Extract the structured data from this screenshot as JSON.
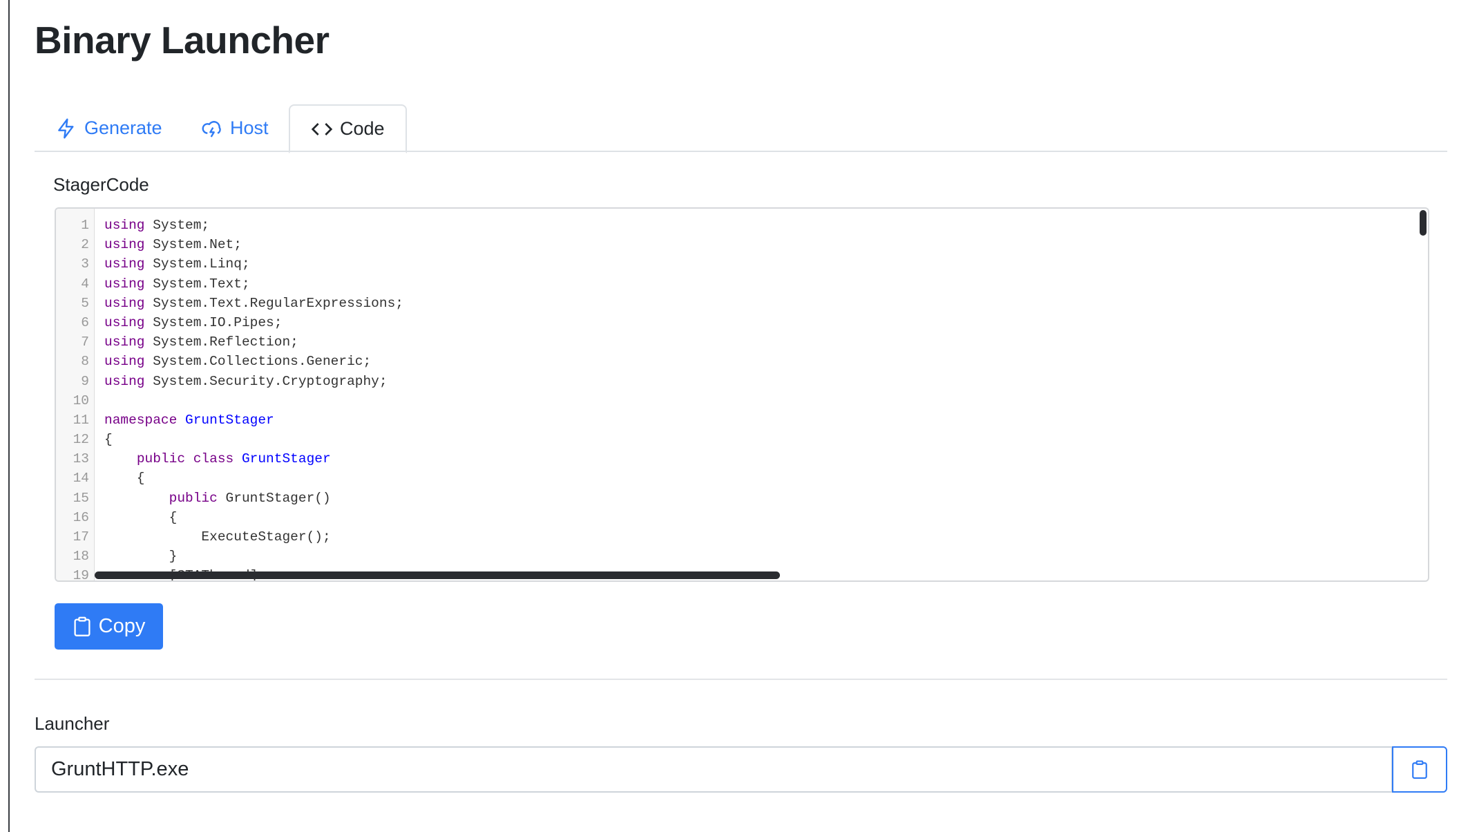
{
  "page": {
    "title": "Binary Launcher"
  },
  "tabs": [
    {
      "label": "Generate",
      "icon": "lightning-icon"
    },
    {
      "label": "Host",
      "icon": "cloud-lightning-icon"
    },
    {
      "label": "Code",
      "icon": "code-icon",
      "active": true
    }
  ],
  "stager": {
    "label": "StagerCode",
    "lines": [
      [
        [
          "kw",
          "using"
        ],
        [
          "",
          "System;"
        ]
      ],
      [
        [
          "kw",
          "using"
        ],
        [
          "",
          "System.Net;"
        ]
      ],
      [
        [
          "kw",
          "using"
        ],
        [
          "",
          "System.Linq;"
        ]
      ],
      [
        [
          "kw",
          "using"
        ],
        [
          "",
          "System.Text;"
        ]
      ],
      [
        [
          "kw",
          "using"
        ],
        [
          "",
          "System.Text.RegularExpressions;"
        ]
      ],
      [
        [
          "kw",
          "using"
        ],
        [
          "",
          "System.IO.Pipes;"
        ]
      ],
      [
        [
          "kw",
          "using"
        ],
        [
          "",
          "System.Reflection;"
        ]
      ],
      [
        [
          "kw",
          "using"
        ],
        [
          "",
          "System.Collections.Generic;"
        ]
      ],
      [
        [
          "kw",
          "using"
        ],
        [
          "",
          "System.Security.Cryptography;"
        ]
      ],
      [],
      [
        [
          "kw",
          "namespace"
        ],
        [
          "def",
          "GruntStager"
        ]
      ],
      [
        [
          "",
          "{"
        ]
      ],
      [
        [
          "",
          "    "
        ],
        [
          "kw",
          "public"
        ],
        [
          "kw",
          "class"
        ],
        [
          "def",
          "GruntStager"
        ]
      ],
      [
        [
          "",
          "    {"
        ]
      ],
      [
        [
          "",
          "        "
        ],
        [
          "kw",
          "public"
        ],
        [
          "",
          "GruntStager()"
        ]
      ],
      [
        [
          "",
          "        {"
        ]
      ],
      [
        [
          "",
          "            ExecuteStager();"
        ]
      ],
      [
        [
          "",
          "        }"
        ]
      ],
      [
        [
          "",
          "        [STAThread]"
        ]
      ]
    ],
    "copy_label": "Copy"
  },
  "launcher": {
    "label": "Launcher",
    "value": "GruntHTTP.exe"
  },
  "colors": {
    "accent": "#2f7bf5",
    "keyword": "#770088",
    "definition": "#0000ff"
  }
}
